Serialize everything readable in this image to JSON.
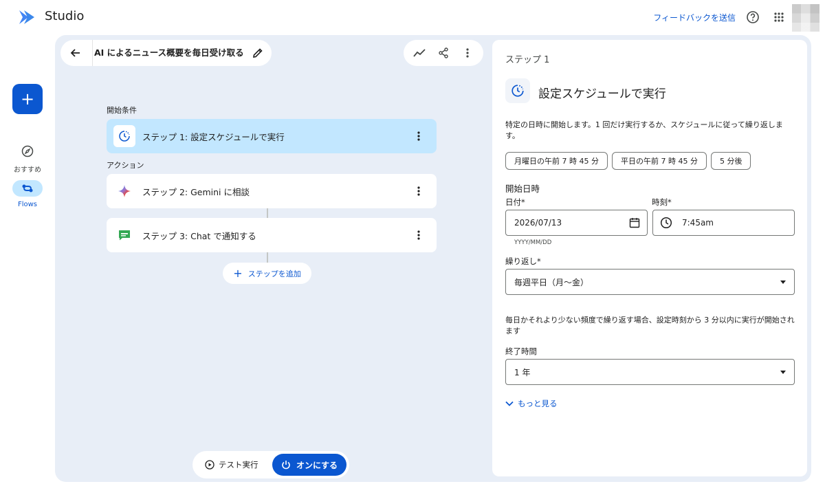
{
  "app": {
    "title": "Studio"
  },
  "header": {
    "feedback_label": "フィードバックを送信"
  },
  "rail": {
    "fab_label": "+",
    "items": [
      {
        "label": "おすすめ",
        "icon": "compass-icon"
      },
      {
        "label": "Flows",
        "icon": "flows-icon"
      }
    ]
  },
  "flow": {
    "name": "AI によるニュース概要を毎日受け取る"
  },
  "canvas": {
    "start_label": "開始条件",
    "action_label": "アクション",
    "steps": [
      {
        "label": "ステップ 1: 設定スケジュールで実行",
        "icon": "schedule-icon"
      },
      {
        "label": "ステップ 2: Gemini に相談",
        "icon": "gemini-sparkle-icon"
      },
      {
        "label": "ステップ 3: Chat で通知する",
        "icon": "chat-icon"
      }
    ],
    "add_step_label": "ステップを追加"
  },
  "bottom": {
    "test_label": "テスト実行",
    "on_label": "オンにする"
  },
  "panel": {
    "step_number": "ステップ 1",
    "title": "設定スケジュールで実行",
    "description": "特定の日時に開始します。1 回だけ実行するか、スケジュールに従って繰り返します。",
    "chips": [
      "月曜日の午前 7 時 45 分",
      "平日の午前 7 時 45 分",
      "5 分後"
    ],
    "start_heading": "開始日時",
    "date_label": "日付*",
    "date_value": "2026/07/13",
    "date_hint": "YYYY/MM/DD",
    "time_label": "時刻*",
    "time_value": "7:45am",
    "repeat_label": "繰り返し*",
    "repeat_value": "毎週平日（月〜金）",
    "repeat_note": "毎日かそれより少ない頻度で繰り返す場合、設定時刻から 3 分以内に実行が開始されます",
    "end_label": "終了時間",
    "end_value": "1 年",
    "more_label": "もっと見る"
  },
  "colors": {
    "accent": "#0b57d0",
    "selected": "#c2e7ff",
    "canvas": "#e8eef7"
  }
}
